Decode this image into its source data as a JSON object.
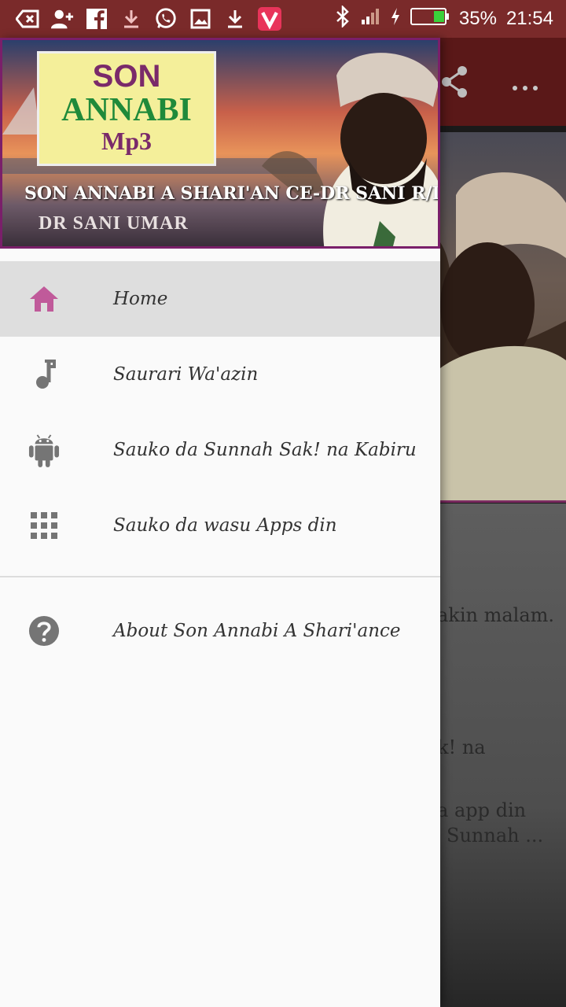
{
  "status_bar": {
    "battery": "35%",
    "time": "21:54"
  },
  "drawer": {
    "header": {
      "logo_line1": "SON",
      "logo_line2": "ANNABI",
      "logo_line3": "Mp3",
      "caption": "SON ANNABI A SHARI'AN CE-DR SANI R/LEMO",
      "subtitle": "DR SANI UMAR"
    },
    "items": [
      {
        "label": "Home",
        "icon": "home-icon",
        "active": true
      },
      {
        "label": "Saurari Wa'azin",
        "icon": "music-note-icon"
      },
      {
        "label": "Sauko da Sunnah Sak! na Kabiru",
        "icon": "android-icon"
      },
      {
        "label": "Sauko da wasu Apps din",
        "icon": "apps-grid-icon"
      }
    ],
    "about": {
      "label": "About Son Annabi A Shari'ance",
      "icon": "help-icon"
    }
  },
  "background": {
    "text1": "akin malam.",
    "text2": "k! na",
    "text3": "a app din",
    "text4": "Sunnah ..."
  },
  "colors": {
    "accent": "#c05a9a",
    "statusbar": "#7a2a2a",
    "icon_gray": "#757575"
  }
}
